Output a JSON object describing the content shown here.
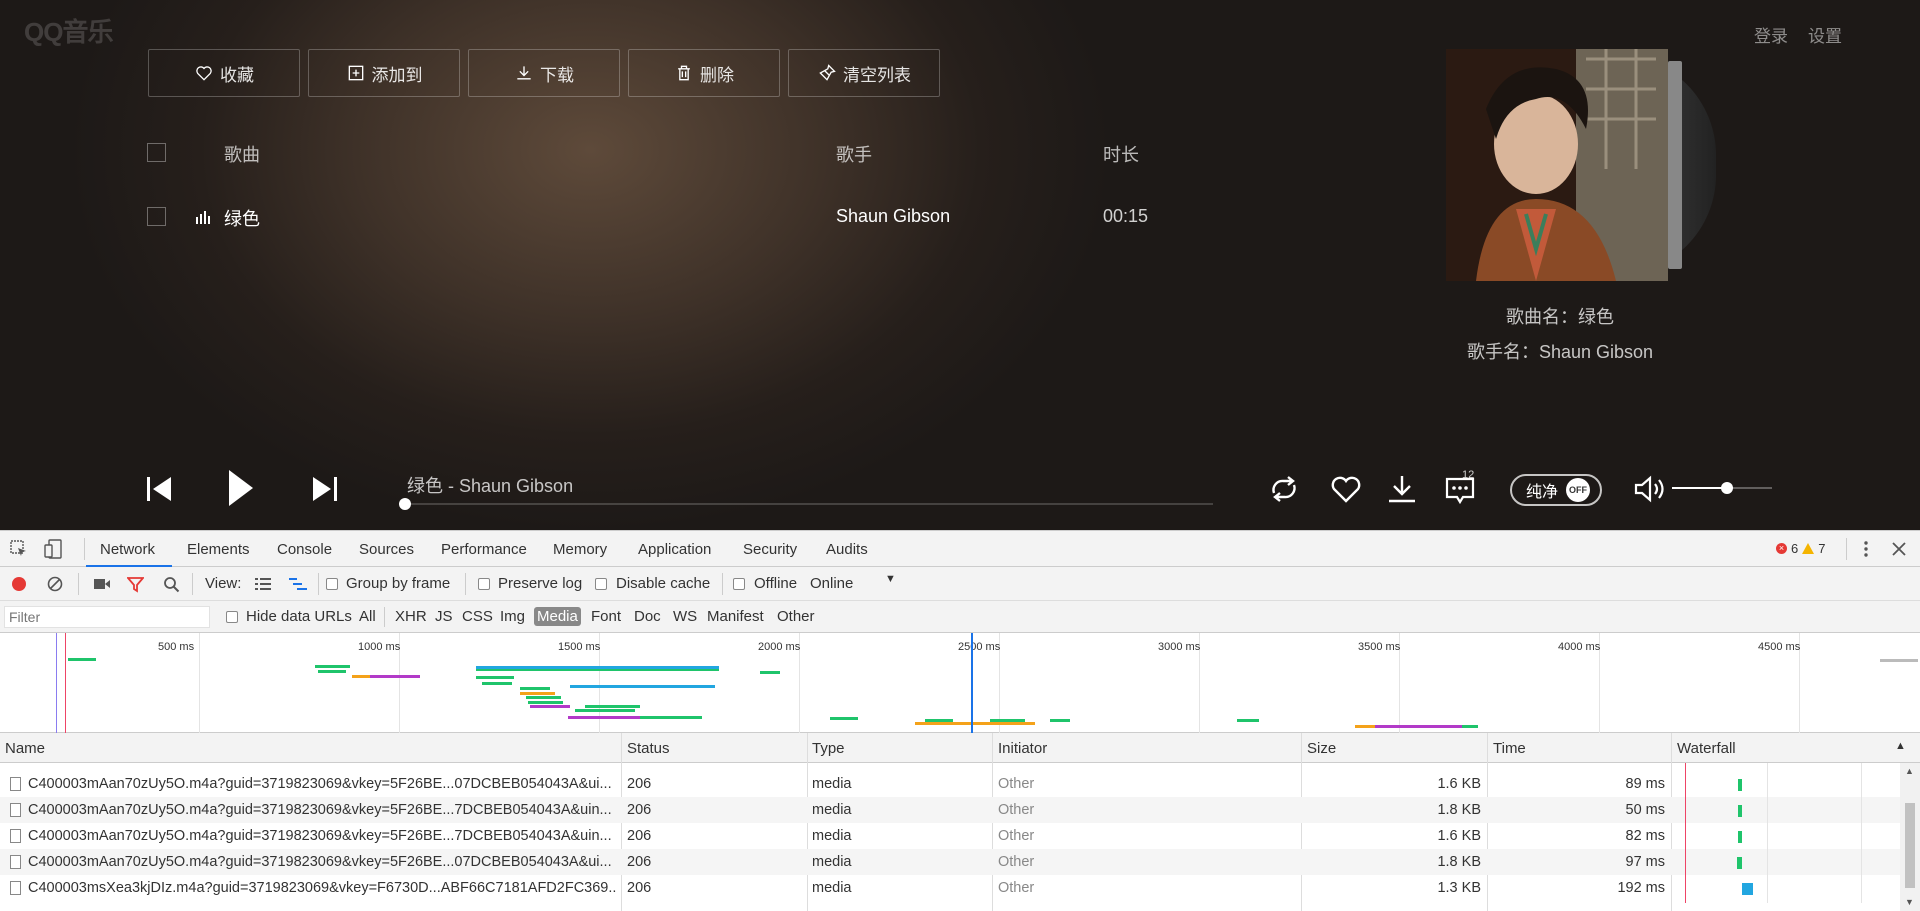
{
  "app": {
    "logo": "QQ音乐",
    "login": "登录",
    "settings": "设置"
  },
  "toolbar": {
    "favorite": "收藏",
    "add_to": "添加到",
    "download": "下载",
    "delete": "删除",
    "clear_list": "清空列表"
  },
  "song_table": {
    "headers": {
      "song": "歌曲",
      "artist": "歌手",
      "duration": "时长"
    },
    "rows": [
      {
        "title": "绿色",
        "artist": "Shaun Gibson",
        "duration": "00:15"
      }
    ]
  },
  "now_playing": {
    "song_label": "歌曲名：绿色",
    "artist_label": "歌手名：Shaun Gibson",
    "progress_title": "绿色 - Shaun Gibson",
    "progress_fraction": 0.0,
    "lyric_count": "12",
    "pure_mode_label": "纯净",
    "pure_mode_state": "OFF",
    "volume_fraction": 0.55
  },
  "devtools": {
    "tabs": [
      "Network",
      "Elements",
      "Console",
      "Sources",
      "Performance",
      "Memory",
      "Application",
      "Security",
      "Audits"
    ],
    "active_tab": "Network",
    "errors": "6",
    "warnings": "7",
    "toolbar": {
      "view_label": "View:",
      "group_by_frame": "Group by frame",
      "preserve_log": "Preserve log",
      "disable_cache": "Disable cache",
      "offline": "Offline",
      "throttle": "Online"
    },
    "filter_bar": {
      "placeholder": "Filter",
      "hide_data_urls": "Hide data URLs",
      "types": [
        "All",
        "XHR",
        "JS",
        "CSS",
        "Img",
        "Media",
        "Font",
        "Doc",
        "WS",
        "Manifest",
        "Other"
      ],
      "active_type": "Media"
    },
    "timeline_ticks": [
      "500 ms",
      "1000 ms",
      "1500 ms",
      "2000 ms",
      "2500 ms",
      "3000 ms",
      "3500 ms",
      "4000 ms",
      "4500 ms"
    ],
    "columns": [
      "Name",
      "Status",
      "Type",
      "Initiator",
      "Size",
      "Time",
      "Waterfall"
    ],
    "requests": [
      {
        "name": "C400003mAan70zUy5O.m4a?guid=3719823069&vkey=5F26BE...07DCBEB054043A&ui...",
        "status": "206",
        "type": "media",
        "initiator": "Other",
        "size": "1.6 KB",
        "time": "89 ms"
      },
      {
        "name": "C400003mAan70zUy5O.m4a?guid=3719823069&vkey=5F26BE...7DCBEB054043A&uin...",
        "status": "206",
        "type": "media",
        "initiator": "Other",
        "size": "1.8 KB",
        "time": "50 ms"
      },
      {
        "name": "C400003mAan70zUy5O.m4a?guid=3719823069&vkey=5F26BE...7DCBEB054043A&uin...",
        "status": "206",
        "type": "media",
        "initiator": "Other",
        "size": "1.6 KB",
        "time": "82 ms"
      },
      {
        "name": "C400003mAan70zUy5O.m4a?guid=3719823069&vkey=5F26BE...07DCBEB054043A&ui...",
        "status": "206",
        "type": "media",
        "initiator": "Other",
        "size": "1.8 KB",
        "time": "97 ms"
      },
      {
        "name": "C400003msXea3kjDIz.m4a?guid=3719823069&vkey=F6730D...ABF66C7181AFD2FC369...",
        "status": "206",
        "type": "media",
        "initiator": "Other",
        "size": "1.3 KB",
        "time": "192 ms"
      }
    ]
  },
  "colors": {
    "accent_blue": "#1a73e8",
    "waterfall_green": "#1fc46b",
    "waterfall_blue": "#22a6e0",
    "error_red": "#e53935",
    "warning_yellow": "#f4b400"
  }
}
